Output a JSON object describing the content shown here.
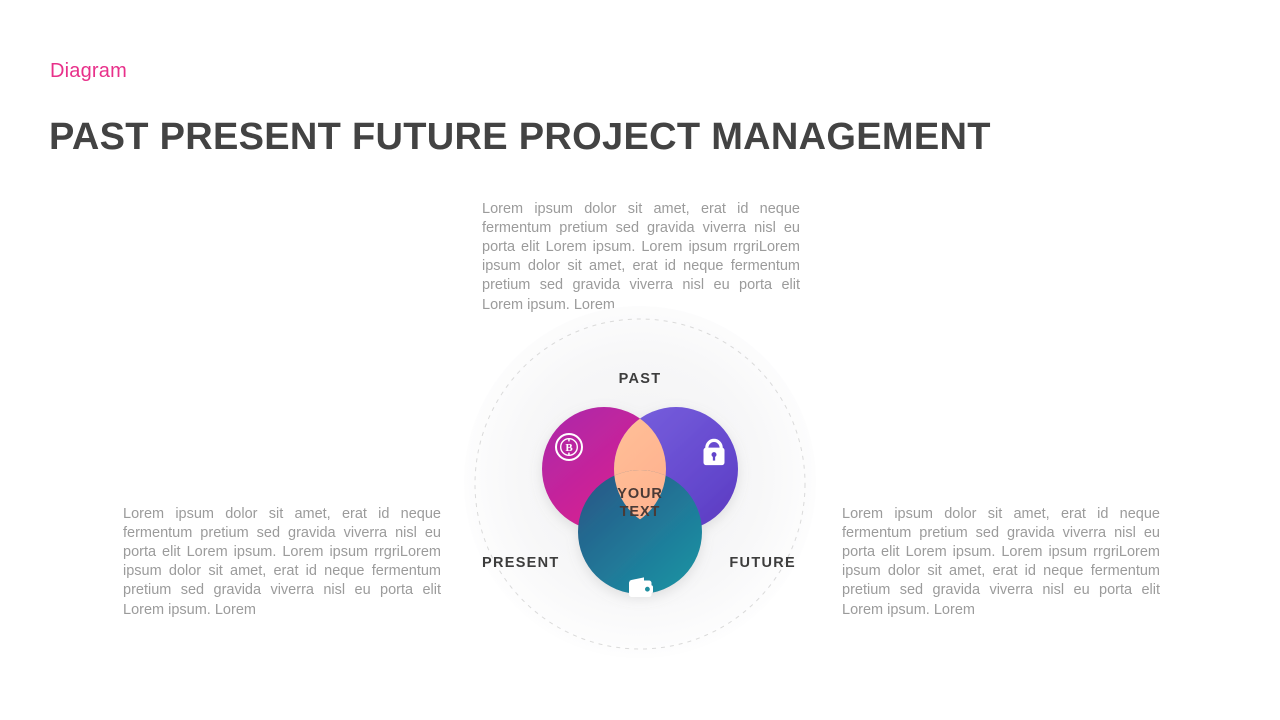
{
  "header": {
    "kicker": "Diagram",
    "title": "PAST PRESENT FUTURE PROJECT MANAGEMENT",
    "kicker_color": "#e8308a",
    "title_color": "#434343"
  },
  "paragraphs": {
    "top": "Lorem ipsum dolor sit amet, erat id neque fermentum pretium sed gravida viverra nisl eu porta elit Lorem ipsum. Lorem ipsum rrgriLorem ipsum dolor sit amet, erat id neque fermentum pretium sed gravida viverra nisl eu porta elit Lorem ipsum. Lorem",
    "left": "Lorem ipsum dolor sit amet, erat id neque fermentum pretium sed gravida viverra nisl eu porta elit Lorem ipsum. Lorem ipsum rrgriLorem ipsum dolor sit amet, erat id neque fermentum pretium sed gravida viverra nisl eu porta elit Lorem ipsum. Lorem",
    "right": "Lorem ipsum dolor sit amet, erat id neque fermentum pretium sed gravida viverra nisl eu porta elit Lorem ipsum. Lorem ipsum rrgriLorem ipsum dolor sit amet, erat id neque fermentum pretium sed gravida viverra nisl eu porta elit Lorem ipsum. Lorem"
  },
  "diagram": {
    "type": "venn-3-petal",
    "center_label_line1": "YOUR",
    "center_label_line2": "TEXT",
    "center_color": "#ffb28e",
    "outline": "dashed-circle",
    "outline_color": "#dcdcdc",
    "petals": [
      {
        "label": "PAST",
        "position": "top-left",
        "icon": "bitcoin-coin-icon",
        "gradient_from": "#a22aa8",
        "gradient_to": "#ef1173"
      },
      {
        "label": "FUTURE",
        "position": "top-right",
        "icon": "lock-icon",
        "gradient_from": "#6f58d8",
        "gradient_to": "#5b2fb0"
      },
      {
        "label": "PRESENT",
        "position": "bottom",
        "icon": "wallet-icon",
        "gradient_from": "#2b5b8c",
        "gradient_to": "#17b2ad"
      }
    ],
    "labels": {
      "past": "PAST",
      "present": "PRESENT",
      "future": "FUTURE"
    }
  }
}
